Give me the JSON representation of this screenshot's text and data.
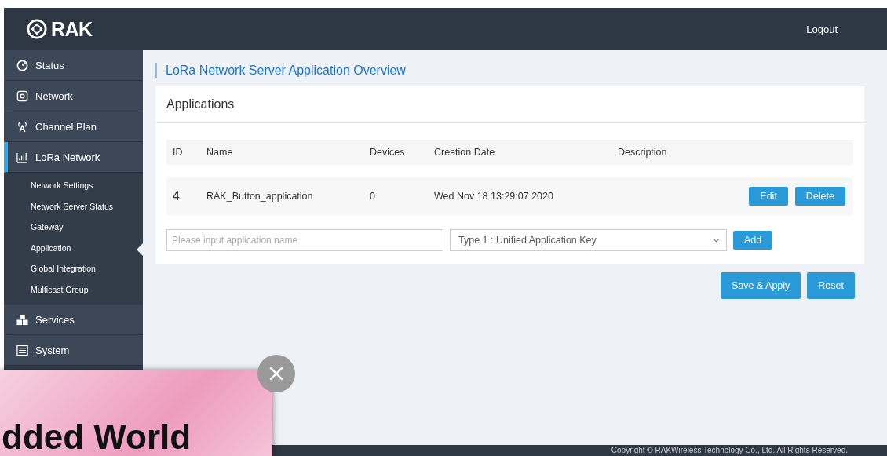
{
  "header": {
    "logo": "RAK",
    "logout": "Logout"
  },
  "sidebar": {
    "items": [
      {
        "label": "Status",
        "kind": "status",
        "selected": false
      },
      {
        "label": "Network",
        "kind": "network",
        "selected": false
      },
      {
        "label": "Channel Plan",
        "kind": "antenna",
        "selected": false
      },
      {
        "label": "LoRa Network",
        "kind": "bars",
        "selected": true,
        "expanded": true,
        "children": [
          {
            "label": "Network Settings",
            "selected": false
          },
          {
            "label": "Network Server Status",
            "selected": false
          },
          {
            "label": "Gateway",
            "selected": false
          },
          {
            "label": "Application",
            "selected": true
          },
          {
            "label": "Global Integration",
            "selected": false
          },
          {
            "label": "Multicast Group",
            "selected": false
          }
        ]
      },
      {
        "label": "Services",
        "kind": "cubes",
        "selected": false
      },
      {
        "label": "System",
        "kind": "list",
        "selected": false
      }
    ]
  },
  "page_title": "LoRa Network Server Application Overview",
  "panel": {
    "title": "Applications",
    "table": {
      "columns": [
        "ID",
        "Name",
        "Devices",
        "Creation Date",
        "Description"
      ],
      "rows": [
        {
          "id": "4",
          "name": "RAK_Button_application",
          "devices": "0",
          "created": "Wed Nov 18 13:29:07 2020",
          "actions": [
            "Edit",
            "Delete"
          ]
        }
      ]
    },
    "form": {
      "name_placeholder": "Please input application name",
      "type_value": "Type 1 : Unified Application Key",
      "add": "Add"
    }
  },
  "buttons": [
    "Save & Apply",
    "Reset"
  ],
  "ad": {
    "text": "dded World"
  },
  "footer": "Copyright © RAKWireless Technology Co., Ltd. All Rights Reserved."
}
